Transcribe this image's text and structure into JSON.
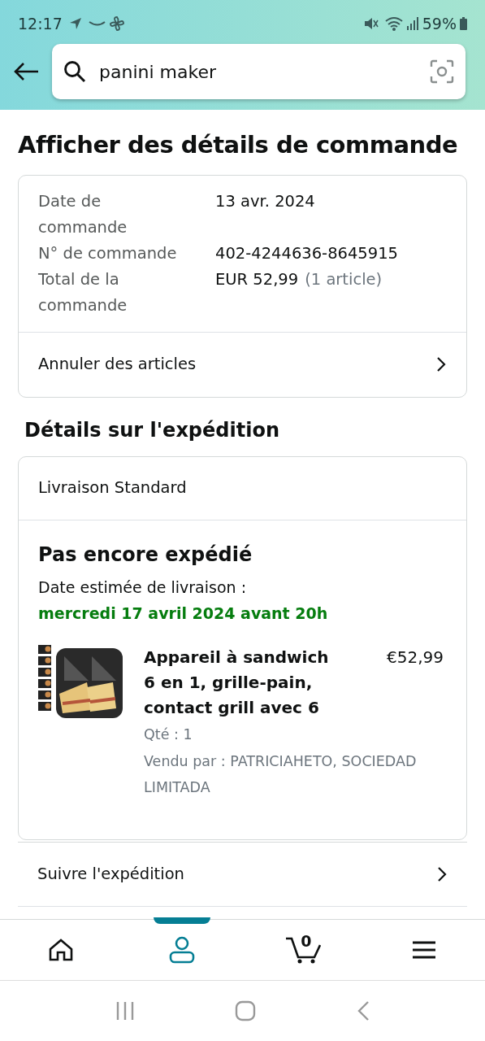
{
  "status_bar": {
    "time": "12:17",
    "battery": "59%"
  },
  "search": {
    "value": "panini maker"
  },
  "title": "Afficher des détails de commande",
  "order_summary": {
    "rows": [
      {
        "label": "Date de commande",
        "value": "13 avr. 2024"
      },
      {
        "label": "N° de commande",
        "value": "402-4244636-8645915"
      },
      {
        "label": "Total de la commande",
        "value": "EUR 52,99",
        "note": "(1 article)"
      }
    ],
    "action": "Annuler des articles"
  },
  "shipment_heading": "Détails sur l'expédition",
  "shipment": {
    "method": "Livraison Standard",
    "status": "Pas encore expédié",
    "estimate_label": "Date estimée de livraison :",
    "estimate_date": "mercredi 17 avril 2024 avant 20h",
    "item": {
      "kind": "picture",
      "title": "Appareil à sandwich 6 en 1, grille-pain, contact grill avec 6",
      "price": "€52,99",
      "quantity": "Qté : 1",
      "seller": "Vendu par : PATRICIAHETO, SOCIEDAD LIMITADA"
    }
  },
  "links": [
    "Suivre l'expédition"
  ],
  "bottom_nav": [
    {
      "kind": "home",
      "selected": false
    },
    {
      "kind": "account",
      "selected": true
    },
    {
      "kind": "cart",
      "selected": false,
      "count": "0"
    },
    {
      "kind": "menu",
      "selected": false
    }
  ]
}
